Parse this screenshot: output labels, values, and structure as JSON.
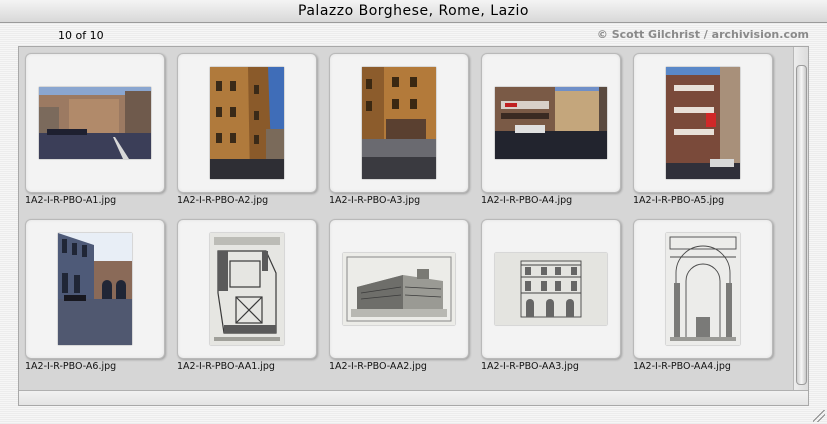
{
  "window": {
    "title": "Palazzo Borghese, Rome, Lazio"
  },
  "header": {
    "count": "10 of 10",
    "copyright": "© Scott Gilchrist / archivision.com"
  },
  "thumbnails": [
    {
      "filename": "1A2-I-R-PBO-A1.jpg",
      "icon": "street-photo-icon"
    },
    {
      "filename": "1A2-I-R-PBO-A2.jpg",
      "icon": "facade-photo-icon"
    },
    {
      "filename": "1A2-I-R-PBO-A3.jpg",
      "icon": "corner-photo-icon"
    },
    {
      "filename": "1A2-I-R-PBO-A4.jpg",
      "icon": "street-photo-icon"
    },
    {
      "filename": "1A2-I-R-PBO-A5.jpg",
      "icon": "balcony-photo-icon"
    },
    {
      "filename": "1A2-I-R-PBO-A6.jpg",
      "icon": "courtyard-photo-icon"
    },
    {
      "filename": "1A2-I-R-PBO-AA1.jpg",
      "icon": "floor-plan-icon"
    },
    {
      "filename": "1A2-I-R-PBO-AA2.jpg",
      "icon": "engraving-icon"
    },
    {
      "filename": "1A2-I-R-PBO-AA3.jpg",
      "icon": "elevation-drawing-icon"
    },
    {
      "filename": "1A2-I-R-PBO-AA4.jpg",
      "icon": "section-drawing-icon"
    }
  ]
}
